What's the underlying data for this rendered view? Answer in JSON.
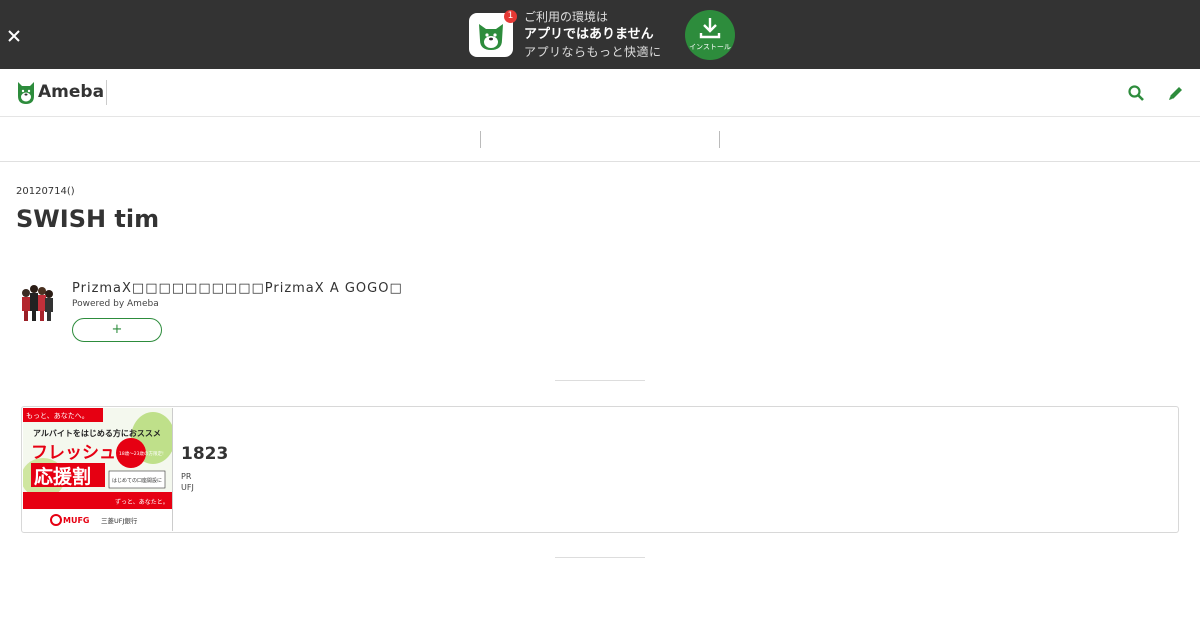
{
  "app_banner": {
    "line1": "ご利用の環境は",
    "line2": "アプリではありません",
    "line3": "アプリならもっと快適に",
    "badge_count": "1",
    "install_label": "インストール"
  },
  "header": {
    "logo_text": "Ameba"
  },
  "article": {
    "date": "20120714()",
    "title": "SWISH tim"
  },
  "blog": {
    "name": "PrizmaX□□□□□□□□□□PrizmaX A GOGO□",
    "powered_by": "Powered by Ameba",
    "follow_label": "+"
  },
  "ad": {
    "title": "1823",
    "pr_label": "PR",
    "source": "UFJ",
    "image_text": {
      "top": "もっと、あなたへ。",
      "headline": "アルバイトをはじめる方におススメ",
      "big1": "フレッシュ",
      "big2": "応援割",
      "circle": "18歳〜23歳の方限定!",
      "sub": "はじめての口座開設に",
      "slogan": "ずっと、あなたと。",
      "brand": "MUFG",
      "bank": "三菱UFJ銀行"
    }
  },
  "colors": {
    "brand_green": "#2d8c3c",
    "banner_bg": "#333333",
    "badge_red": "#e53935",
    "ad_red": "#e60012"
  },
  "icons": [
    "close-icon",
    "ameba-app-icon",
    "download-icon",
    "ameba-logo-icon",
    "search-icon",
    "pencil-icon"
  ]
}
